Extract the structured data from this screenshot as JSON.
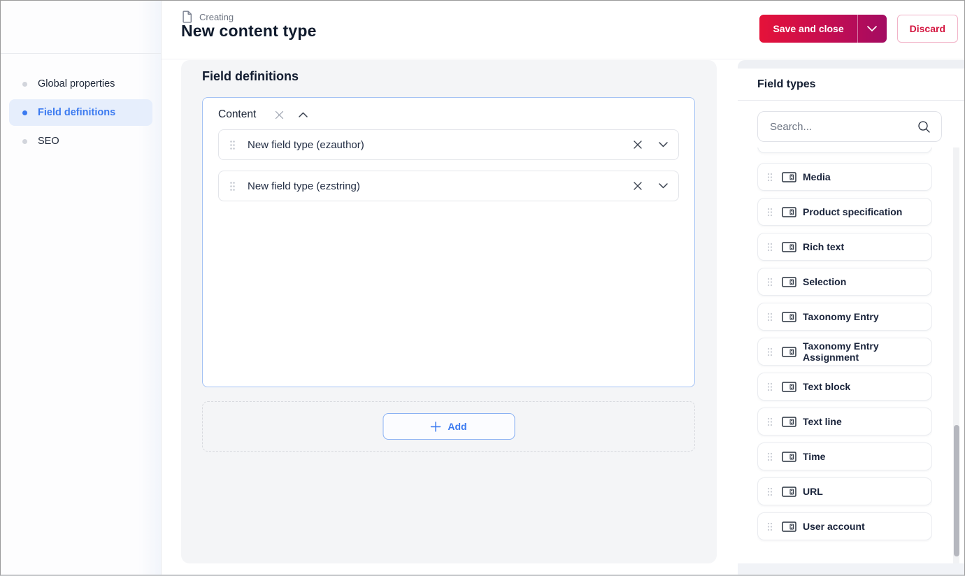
{
  "header": {
    "breadcrumb": "Creating",
    "title": "New content type",
    "save_button": "Save and close",
    "discard_button": "Discard"
  },
  "sidebar": {
    "items": [
      {
        "label": "Global properties",
        "active": false
      },
      {
        "label": "Field definitions",
        "active": true
      },
      {
        "label": "SEO",
        "active": false
      }
    ]
  },
  "main": {
    "title": "Field definitions",
    "group": {
      "name": "Content",
      "fields": [
        "New field type (ezauthor)",
        "New field type (ezstring)"
      ]
    },
    "add_button": "Add"
  },
  "field_types": {
    "title": "Field types",
    "search_placeholder": "Search...",
    "items": [
      "Media",
      "Product specification",
      "Rich text",
      "Selection",
      "Taxonomy Entry",
      "Taxonomy Entry Assignment",
      "Text block",
      "Text line",
      "Time",
      "URL",
      "User account"
    ]
  },
  "colors": {
    "accent_blue": "#3b7af0",
    "primary_gradient_start": "#e51239",
    "primary_gradient_end": "#a30c62",
    "discard_red": "#d4153f",
    "active_nav_bg": "#e6eefc",
    "panel_gray": "#f4f5f7",
    "group_border_blue": "#a5c3f4"
  }
}
